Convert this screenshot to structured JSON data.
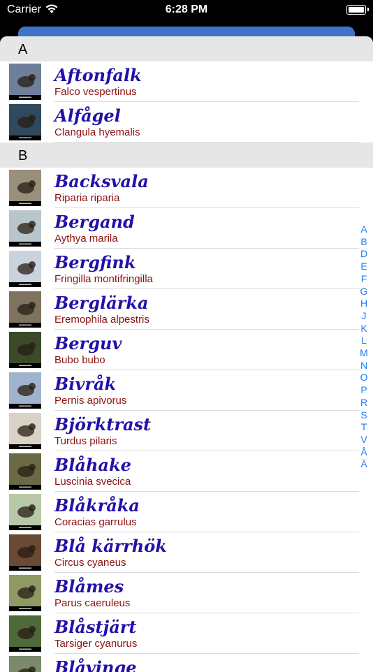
{
  "status_bar": {
    "carrier": "Carrier",
    "time": "6:28 PM"
  },
  "sections": [
    {
      "letter": "A",
      "rows": [
        {
          "name": "Aftonfalk",
          "latin": "Falco vespertinus",
          "thumb_bg": "#6f7f9a"
        },
        {
          "name": "Alfågel",
          "latin": "Clangula hyemalis",
          "thumb_bg": "#2f4a5e"
        }
      ]
    },
    {
      "letter": "B",
      "rows": [
        {
          "name": "Backsvala",
          "latin": "Riparia riparia",
          "thumb_bg": "#9a8f7a"
        },
        {
          "name": "Bergand",
          "latin": "Aythya marila",
          "thumb_bg": "#b9c5cc"
        },
        {
          "name": "Bergfink",
          "latin": "Fringilla montifringilla",
          "thumb_bg": "#c9d3dd"
        },
        {
          "name": "Berglärka",
          "latin": "Eremophila alpestris",
          "thumb_bg": "#7f7360"
        },
        {
          "name": "Berguv",
          "latin": "Bubo bubo",
          "thumb_bg": "#3d4a2a"
        },
        {
          "name": "Bivråk",
          "latin": "Pernis apivorus",
          "thumb_bg": "#9fb4cc"
        },
        {
          "name": "Björktrast",
          "latin": "Turdus pilaris",
          "thumb_bg": "#d8d2c7"
        },
        {
          "name": "Blåhake",
          "latin": "Luscinia svecica",
          "thumb_bg": "#6b6a46"
        },
        {
          "name": "Blåkråka",
          "latin": "Coracias garrulus",
          "thumb_bg": "#b8c9a8"
        },
        {
          "name": "Blå kärrhök",
          "latin": "Circus cyaneus",
          "thumb_bg": "#6a4a35"
        },
        {
          "name": "Blåmes",
          "latin": "Parus caeruleus",
          "thumb_bg": "#8e9a66"
        },
        {
          "name": "Blåstjärt",
          "latin": "Tarsiger cyanurus",
          "thumb_bg": "#4f6a3a"
        },
        {
          "name": "Blåvinge",
          "latin": "",
          "thumb_bg": "#7a8a6a"
        }
      ]
    }
  ],
  "index_letters": [
    "A",
    "B",
    "D",
    "E",
    "F",
    "G",
    "H",
    "J",
    "K",
    "L",
    "M",
    "N",
    "O",
    "P",
    "R",
    "S",
    "T",
    "V",
    "Å",
    "Ä"
  ]
}
